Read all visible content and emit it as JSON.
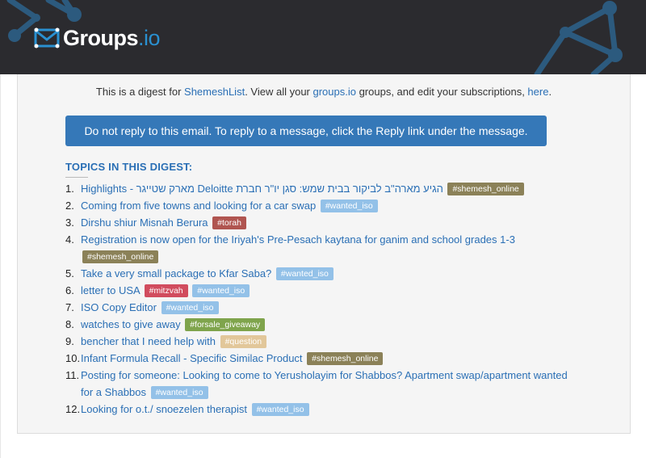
{
  "brand": {
    "name": "Groups",
    "suffix": ".io"
  },
  "intro": {
    "prefix": "This is a digest for ",
    "group_name": "ShemeshList",
    "middle": ". View all your ",
    "groups_link": "groups.io",
    "middle2": " groups, and edit your subscriptions, ",
    "here_link": "here",
    "suffix": "."
  },
  "banner": "Do not reply to this email. To reply to a message, click the Reply link under the message.",
  "topics_heading": "TOPICS IN THIS DIGEST:",
  "topics": [
    {
      "num": "1.",
      "title": "Highlights - מארק שטייגר Deloitte הגיע מארה\"ב לביקור בבית שמש: סגן יו\"ר חברת",
      "tags": [
        {
          "label": "#shemesh_online",
          "color": "#8b8158"
        }
      ]
    },
    {
      "num": "2.",
      "title": "Coming from five towns and looking for a car swap",
      "tags": [
        {
          "label": "#wanted_iso",
          "color": "#93c1e8"
        }
      ]
    },
    {
      "num": "3.",
      "title": "Dirshu shiur Misnah Berura",
      "tags": [
        {
          "label": "#torah",
          "color": "#b05550"
        }
      ]
    },
    {
      "num": "4.",
      "title": "Registration is now open for the Iriyah's Pre-Pesach kaytana for ganim and school grades 1-3",
      "tags": [
        {
          "label": "#shemesh_online",
          "color": "#8b8158"
        }
      ]
    },
    {
      "num": "5.",
      "title": "Take a very small package to Kfar Saba?",
      "tags": [
        {
          "label": "#wanted_iso",
          "color": "#93c1e8"
        }
      ]
    },
    {
      "num": "6.",
      "title": "letter to USA",
      "tags": [
        {
          "label": "#mitzvah",
          "color": "#d14c5e"
        },
        {
          "label": "#wanted_iso",
          "color": "#93c1e8"
        }
      ]
    },
    {
      "num": "7.",
      "title": "ISO Copy Editor",
      "tags": [
        {
          "label": "#wanted_iso",
          "color": "#93c1e8"
        }
      ]
    },
    {
      "num": "8.",
      "title": "watches to give away",
      "tags": [
        {
          "label": "#forsale_giveaway",
          "color": "#7fa44c"
        }
      ]
    },
    {
      "num": "9.",
      "title": "bencher that I need help with",
      "tags": [
        {
          "label": "#question",
          "color": "#e2c79a"
        }
      ]
    },
    {
      "num": "10.",
      "title": "Infant Formula Recall - Specific Similac Product",
      "tags": [
        {
          "label": "#shemesh_online",
          "color": "#8b8158"
        }
      ]
    },
    {
      "num": "11.",
      "title": "Posting for someone: Looking to come to Yerusholayim for Shabbos? Apartment swap/apartment wanted for a Shabbos",
      "tags": [
        {
          "label": "#wanted_iso",
          "color": "#93c1e8"
        }
      ]
    },
    {
      "num": "12.",
      "title": "Looking for o.t./ snoezelen therapist",
      "tags": [
        {
          "label": "#wanted_iso",
          "color": "#93c1e8"
        }
      ]
    }
  ],
  "colors": {
    "header_bg": "#2b2b2f",
    "link": "#2a6fb5",
    "banner_bg": "#3578b8",
    "brand_accent": "#2a90d0"
  }
}
